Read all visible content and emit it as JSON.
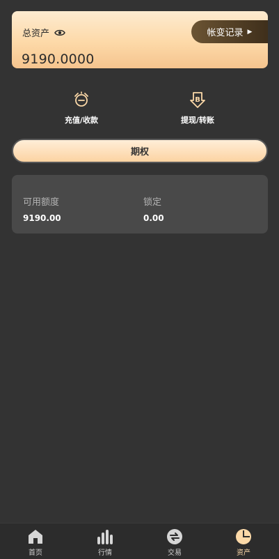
{
  "asset_card": {
    "label": "总资产",
    "value": "9190.0000",
    "history_label": "帐变记录"
  },
  "actions": [
    {
      "label": "充值/收款",
      "icon": "alarm-clock-icon"
    },
    {
      "label": "提现/转账",
      "icon": "bitcoin-withdraw-icon"
    }
  ],
  "active_tab": "期权",
  "balance": {
    "available_label": "可用额度",
    "available_value": "9190.00",
    "locked_label": "锁定",
    "locked_value": "0.00"
  },
  "tabbar": {
    "items": [
      {
        "label": "首页",
        "icon": "home-icon"
      },
      {
        "label": "行情",
        "icon": "chart-bars-icon"
      },
      {
        "label": "交易",
        "icon": "exchange-icon"
      },
      {
        "label": "资产",
        "icon": "pie-chart-icon"
      }
    ],
    "active_index": 3
  },
  "colors": {
    "background": "#333333",
    "accent": "#fcd9a8",
    "card": "#494949"
  }
}
